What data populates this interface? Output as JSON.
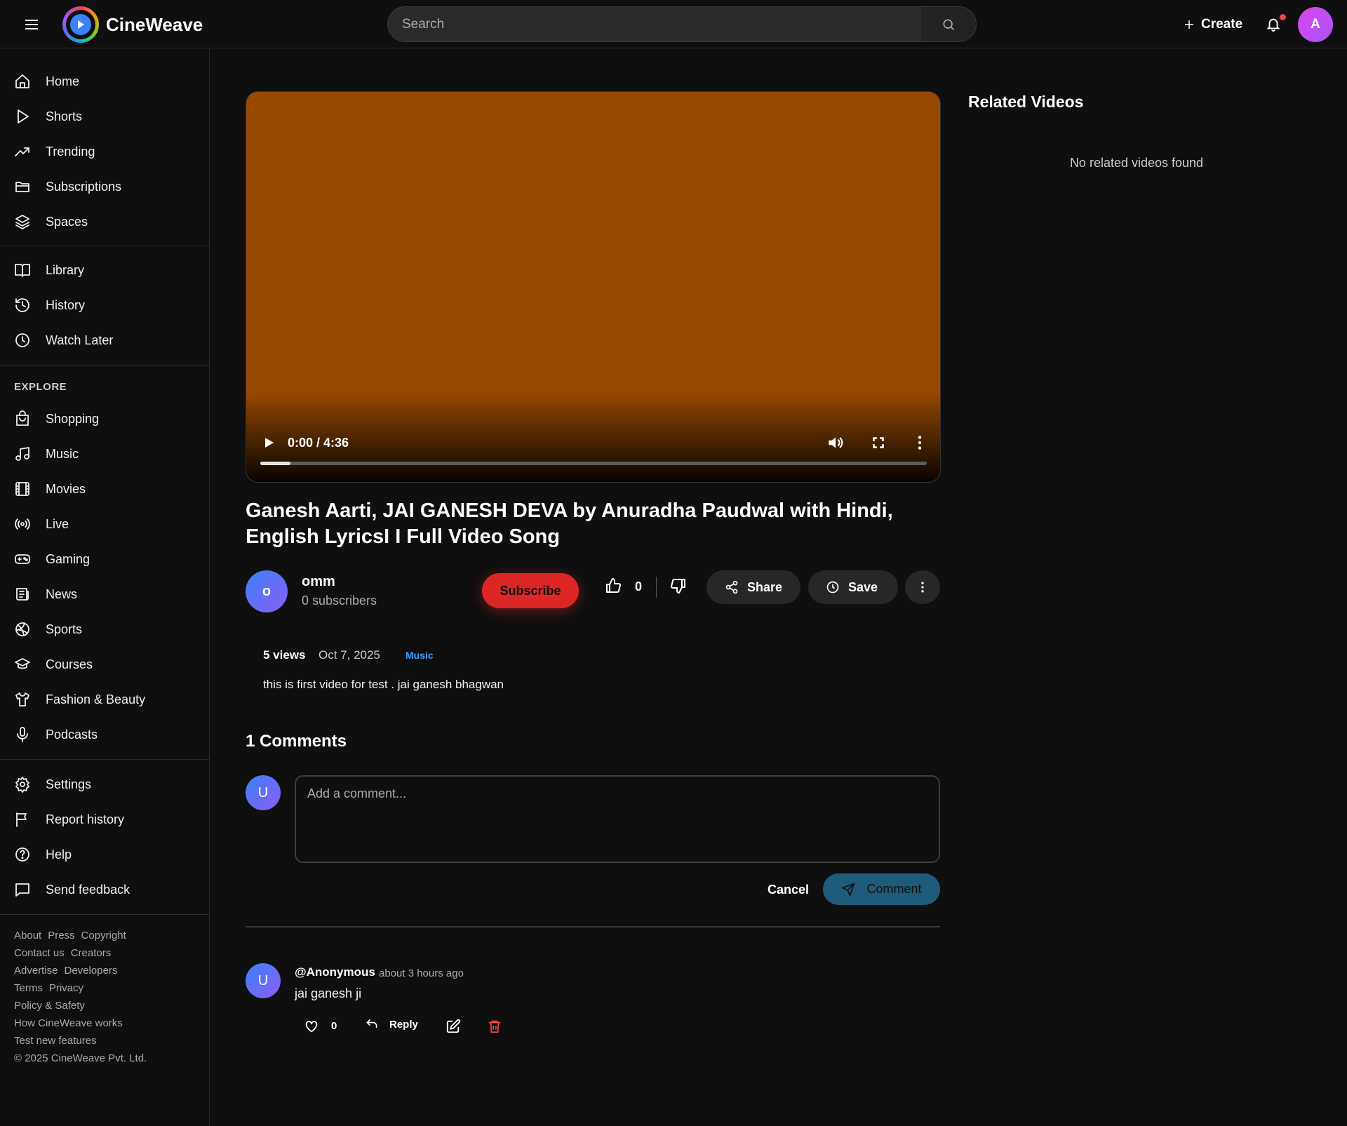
{
  "app": {
    "name": "CineWeave"
  },
  "search": {
    "placeholder": "Search"
  },
  "header": {
    "create_label": "Create",
    "avatar_initial": "A"
  },
  "sidebar": {
    "main": [
      {
        "label": "Home",
        "icon": "home-icon"
      },
      {
        "label": "Shorts",
        "icon": "play-outline-icon"
      },
      {
        "label": "Trending",
        "icon": "trending-icon"
      },
      {
        "label": "Subscriptions",
        "icon": "folder-icon"
      },
      {
        "label": "Spaces",
        "icon": "layers-icon"
      }
    ],
    "library": [
      {
        "label": "Library",
        "icon": "book-icon"
      },
      {
        "label": "History",
        "icon": "history-icon"
      },
      {
        "label": "Watch Later",
        "icon": "clock-icon"
      }
    ],
    "explore_heading": "EXPLORE",
    "explore": [
      {
        "label": "Shopping",
        "icon": "bag-icon"
      },
      {
        "label": "Music",
        "icon": "music-icon"
      },
      {
        "label": "Movies",
        "icon": "film-icon"
      },
      {
        "label": "Live",
        "icon": "live-icon"
      },
      {
        "label": "Gaming",
        "icon": "gamepad-icon"
      },
      {
        "label": "News",
        "icon": "newspaper-icon"
      },
      {
        "label": "Sports",
        "icon": "ball-icon"
      },
      {
        "label": "Courses",
        "icon": "graduation-cap-icon"
      },
      {
        "label": "Fashion & Beauty",
        "icon": "shirt-icon"
      },
      {
        "label": "Podcasts",
        "icon": "mic-icon"
      }
    ],
    "settings": [
      {
        "label": "Settings",
        "icon": "gear-icon"
      },
      {
        "label": "Report history",
        "icon": "flag-icon"
      },
      {
        "label": "Help",
        "icon": "help-icon"
      },
      {
        "label": "Send feedback",
        "icon": "feedback-icon"
      }
    ],
    "footer_rows": [
      [
        "About",
        "Press",
        "Copyright"
      ],
      [
        "Contact us",
        "Creators"
      ],
      [
        "Advertise",
        "Developers"
      ],
      [
        "Terms",
        "Privacy"
      ],
      [
        "Policy & Safety"
      ],
      [
        "How CineWeave works"
      ],
      [
        "Test new features"
      ],
      [
        "© 2025 CineWeave Pvt. Ltd."
      ]
    ]
  },
  "player": {
    "time": "0:00 / 4:36",
    "progress_fraction": 0.045,
    "video_color": "#984900"
  },
  "video": {
    "title": "Ganesh Aarti, JAI GANESH DEVA by Anuradha Paudwal with Hindi, English LyricsI I Full Video Song",
    "views": "5 views",
    "date": "Oct 7, 2025",
    "category": "Music",
    "description": "this is first video for test . jai ganesh bhagwan"
  },
  "channel": {
    "avatar_initial": "o",
    "name": "omm",
    "subscribers": "0 subscribers"
  },
  "actions": {
    "subscribe_label": "Subscribe",
    "like_count": "0",
    "share_label": "Share",
    "save_label": "Save"
  },
  "comments": {
    "title": "1 Comments",
    "user_initial": "U",
    "input_placeholder": "Add a comment...",
    "cancel_label": "Cancel",
    "submit_label": "Comment",
    "items": [
      {
        "avatar_initial": "U",
        "author": "@Anonymous",
        "time": "about 3 hours ago",
        "text": "jai ganesh ji",
        "likes": "0",
        "reply_label": "Reply"
      }
    ]
  },
  "related": {
    "title": "Related Videos",
    "empty_text": "No related videos found"
  },
  "colors": {
    "background": "#0f0f0f",
    "accent_red": "#dc2626",
    "accent_blue": "#3b9eff",
    "comment_button": "#1e5a7a"
  }
}
